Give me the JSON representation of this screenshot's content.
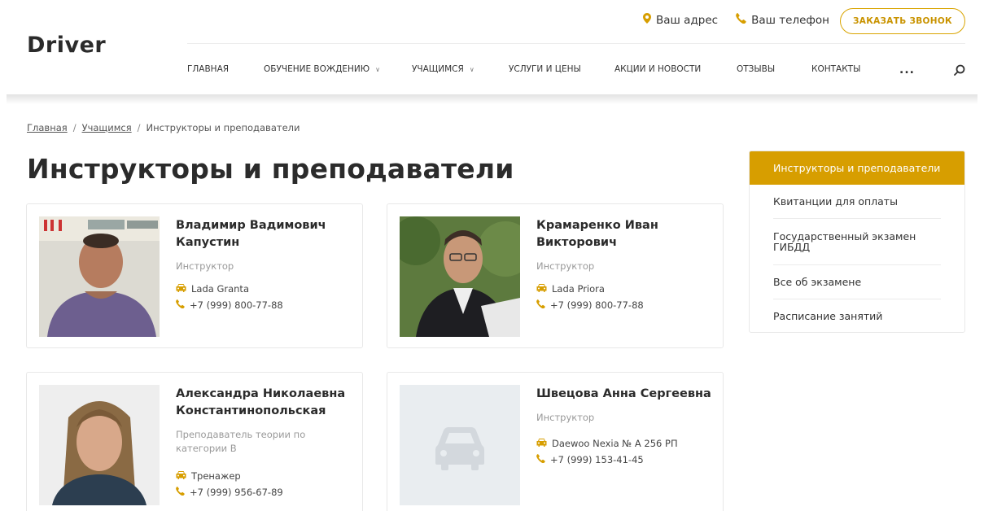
{
  "header": {
    "logo": "Driver",
    "address_label": "Ваш адрес",
    "phone_label": "Ваш телефон",
    "call_button": "ЗАКАЗАТЬ ЗВОНОК",
    "nav": [
      {
        "label": "ГЛАВНАЯ"
      },
      {
        "label": "ОБУЧЕНИЕ ВОЖДЕНИЮ"
      },
      {
        "label": "УЧАЩИМСЯ"
      },
      {
        "label": "УСЛУГИ И ЦЕНЫ"
      },
      {
        "label": "АКЦИИ И НОВОСТИ"
      },
      {
        "label": "ОТЗЫВЫ"
      },
      {
        "label": "КОНТАКТЫ"
      }
    ],
    "more": "...",
    "accent_color": "#d79e00"
  },
  "breadcrumb": {
    "home": "Главная",
    "students": "Учащимся",
    "current": "Инструкторы и преподаватели",
    "separator": "/"
  },
  "page_title": "Инструкторы и преподаватели",
  "cards": [
    {
      "name": "Владимир Вадимович Капустин",
      "role": "Инструктор",
      "car": "Lada Granta",
      "phone": "+7 (999) 800-77-88"
    },
    {
      "name": "Крамаренко Иван Викторович",
      "role": "Инструктор",
      "car": "Lada Priora",
      "phone": "+7 (999) 800-77-88"
    },
    {
      "name": "Александра Николаевна Константинопольская",
      "role": "Преподаватель теории по категории B",
      "car": "Тренажер",
      "phone": "+7 (999) 956-67-89"
    },
    {
      "name": "Швецова Анна Сергеевна",
      "role": "Инструктор",
      "car": "Daewoo Nexia № А 256 РП",
      "phone": "+7 (999) 153-41-45"
    }
  ],
  "sidebar": {
    "active": "Инструкторы и преподаватели",
    "items": [
      {
        "label": "Квитанции для оплаты"
      },
      {
        "label": "Государственный экзамен ГИБДД"
      },
      {
        "label": "Все об экзамене"
      },
      {
        "label": "Расписание занятий"
      }
    ]
  }
}
